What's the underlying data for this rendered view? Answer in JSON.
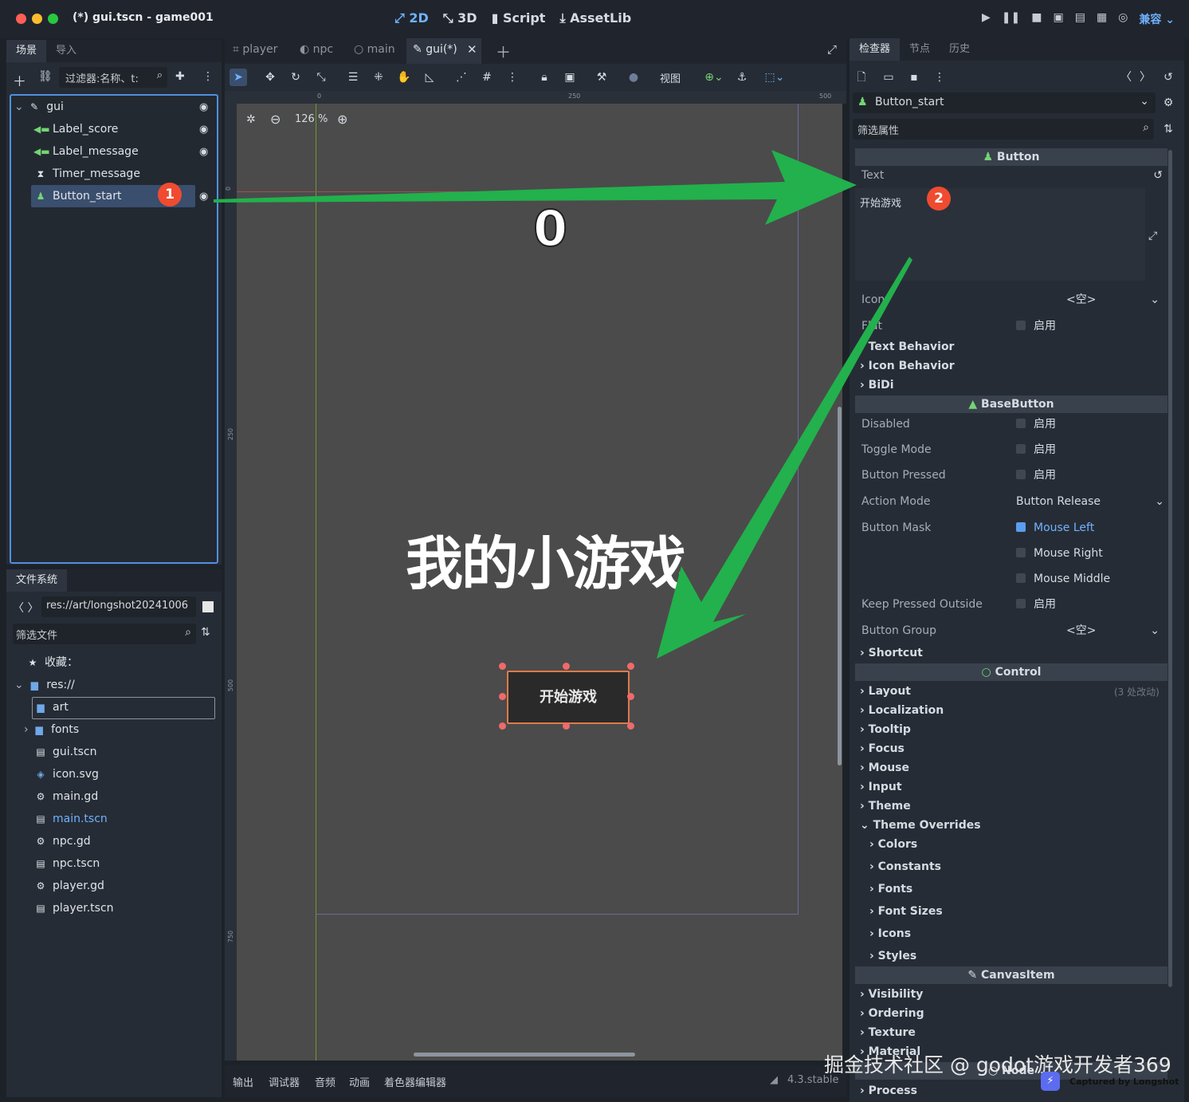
{
  "window": {
    "title": "(*) gui.tscn - game001",
    "nav": [
      "2D",
      "3D",
      "Script",
      "AssetLib"
    ],
    "nav_icons": [
      "canvas-2d-icon",
      "cube-3d-icon",
      "script-icon",
      "assetlib-icon"
    ],
    "compat_label": "兼容"
  },
  "scene_panel": {
    "tabs": [
      "场景",
      "导入"
    ],
    "filter_placeholder": "过滤器:名称、t:",
    "nodes": [
      {
        "label": "gui",
        "icon": "control-icon"
      },
      {
        "label": "Label_score",
        "icon": "label-icon"
      },
      {
        "label": "Label_message",
        "icon": "label-icon"
      },
      {
        "label": "Timer_message",
        "icon": "timer-icon"
      },
      {
        "label": "Button_start",
        "icon": "button-icon"
      }
    ]
  },
  "filesystem": {
    "tab": "文件系统",
    "path": "res://art/longshot20241006",
    "filter_placeholder": "筛选文件",
    "favorites": "收藏：",
    "items": [
      {
        "label": "res://",
        "type": "folder"
      },
      {
        "label": "art",
        "type": "folder"
      },
      {
        "label": "fonts",
        "type": "folder"
      },
      {
        "label": "gui.tscn",
        "type": "scene"
      },
      {
        "label": "icon.svg",
        "type": "image"
      },
      {
        "label": "main.gd",
        "type": "script"
      },
      {
        "label": "main.tscn",
        "type": "scene"
      },
      {
        "label": "npc.gd",
        "type": "script"
      },
      {
        "label": "npc.tscn",
        "type": "scene"
      },
      {
        "label": "player.gd",
        "type": "script"
      },
      {
        "label": "player.tscn",
        "type": "scene"
      }
    ]
  },
  "editor": {
    "tabs": [
      "player",
      "npc",
      "main",
      "gui(*)"
    ],
    "view_label": "视图",
    "zoom": "126 %",
    "ruler_marks": [
      "0",
      "250",
      "500"
    ],
    "vertical_ruler_marks": [
      "0",
      "250",
      "500",
      "750"
    ],
    "score_text": "0",
    "game_title": "我的小游戏",
    "button_text": "开始游戏"
  },
  "bottom_panel": {
    "tabs": [
      "输出",
      "调试器",
      "音频",
      "动画",
      "着色器编辑器"
    ],
    "version": "4.3.stable"
  },
  "inspector": {
    "tabs": [
      "检查器",
      "节点",
      "历史"
    ],
    "node_name": "Button_start",
    "filter_placeholder": "筛选属性",
    "button_section": "Button",
    "text_label": "Text",
    "text_value": "开始游戏",
    "icon_label": "Icon",
    "empty_value": "<空>",
    "flat_label": "Flat",
    "enable_label": "启用",
    "groups_button": [
      "Text Behavior",
      "Icon Behavior",
      "BiDi"
    ],
    "basebutton_section": "BaseButton",
    "disabled_label": "Disabled",
    "toggle_label": "Toggle Mode",
    "pressed_label": "Button Pressed",
    "action_mode_label": "Action Mode",
    "action_mode_value": "Button Release",
    "button_mask_label": "Button Mask",
    "mask_options": [
      "Mouse Left",
      "Mouse Right",
      "Mouse Middle"
    ],
    "keep_pressed_label": "Keep Pressed Outside",
    "button_group_label": "Button Group",
    "shortcut_group": "Shortcut",
    "control_section": "Control",
    "layout_group": "Layout",
    "layout_changes": "(3 处改动)",
    "control_groups": [
      "Localization",
      "Tooltip",
      "Focus",
      "Mouse",
      "Input",
      "Theme",
      "Theme Overrides"
    ],
    "override_groups": [
      "Colors",
      "Constants",
      "Fonts",
      "Font Sizes",
      "Icons",
      "Styles"
    ],
    "canvasitem_section": "CanvasItem",
    "canvas_groups": [
      "Visibility",
      "Ordering",
      "Texture",
      "Material"
    ],
    "node_section": "Node",
    "process_group": "Process"
  },
  "annotations": {
    "badge_1": "1",
    "badge_2": "2",
    "arrow_color": "#22b14c",
    "badge_color": "#f04b30"
  },
  "watermark": {
    "text": "掘金技术社区 @ godot游戏开发者369",
    "capture": "Captured by Longshot"
  }
}
